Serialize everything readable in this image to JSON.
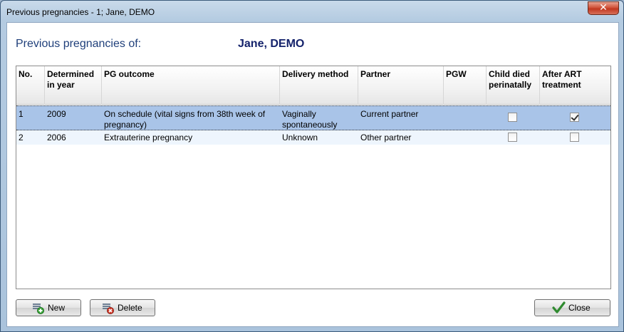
{
  "window": {
    "title": "Previous pregnancies - 1; Jane, DEMO",
    "close_glyph": "✕"
  },
  "header": {
    "label": "Previous pregnancies of:",
    "patient": "Jane, DEMO"
  },
  "table": {
    "columns": [
      "No.",
      "Determined in year",
      "PG outcome",
      "Delivery method",
      "Partner",
      "PGW",
      "Child died perinatally",
      "After ART treatment"
    ],
    "rows": [
      {
        "no": "1",
        "year": "2009",
        "outcome": "On schedule (vital signs from 38th week of pregnancy)",
        "delivery": "Vaginally spontaneously",
        "partner": "Current partner",
        "pgw": "",
        "child_died": false,
        "after_art": true
      },
      {
        "no": "2",
        "year": "2006",
        "outcome": "Extrauterine pregnancy",
        "delivery": "Unknown",
        "partner": "Other partner",
        "pgw": "",
        "child_died": false,
        "after_art": false
      }
    ]
  },
  "buttons": {
    "new": "New",
    "delete": "Delete",
    "close": "Close"
  },
  "icons": {
    "new": "add-icon",
    "delete": "delete-icon",
    "close": "checkmark-icon"
  },
  "colors": {
    "selected_row": "#a9c4e8",
    "heading": "#1f3f7a",
    "patient": "#14226b"
  }
}
